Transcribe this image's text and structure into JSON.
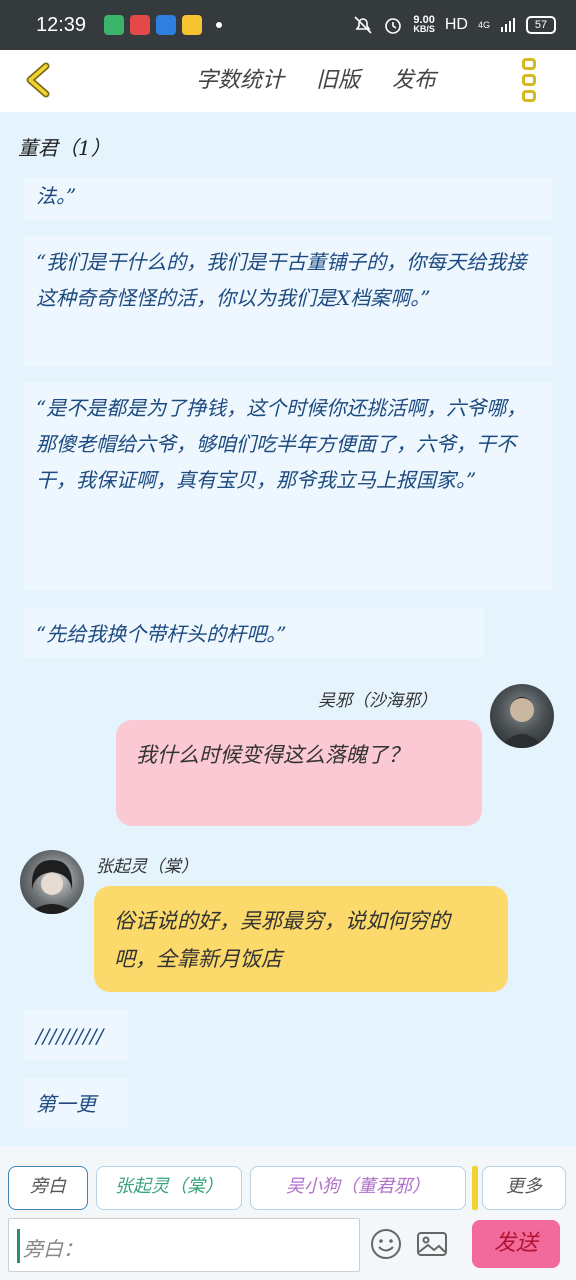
{
  "status_bar": {
    "time": "12:39",
    "net_speed_value": "9.00",
    "net_speed_unit": "KB/S",
    "hd": "HD",
    "signal": "4G",
    "battery": "57"
  },
  "header": {
    "menu": [
      "字数统计",
      "旧版",
      "发布"
    ]
  },
  "chat": {
    "chapter_title": "董君（1）",
    "narration": [
      "法。”",
      "“我们是干什么的，我们是干古董铺子的，你每天给我接这种奇奇怪怪的活，你以为我们是X档案啊。”",
      "“是不是都是为了挣钱，这个时候你还挑活啊，六爷哪，那傻老帽给六爷，够咱们吃半年方便面了，六爷，干不干，我保证啊，真有宝贝，那爷我立马上报国家。”",
      "“先给我换个带杆头的杆吧。”"
    ],
    "messages": [
      {
        "speaker": "吴邪（沙海邪）",
        "text": "我什么时候变得这么落魄了？",
        "side": "right",
        "color": "#fbc9d3"
      },
      {
        "speaker": "张起灵（棠）",
        "text": "俗话说的好，吴邪最穷，说如何穷的吧，全靠新月饭店",
        "side": "left",
        "color": "#fbd96a"
      }
    ],
    "extra_lines": [
      "//////////",
      "第一更"
    ]
  },
  "bottom": {
    "role_chips": [
      "旁白",
      "张起灵（棠）",
      "吴小狗（董君邪）",
      "更多"
    ],
    "input_placeholder": "旁白：",
    "send_label": "发送"
  }
}
